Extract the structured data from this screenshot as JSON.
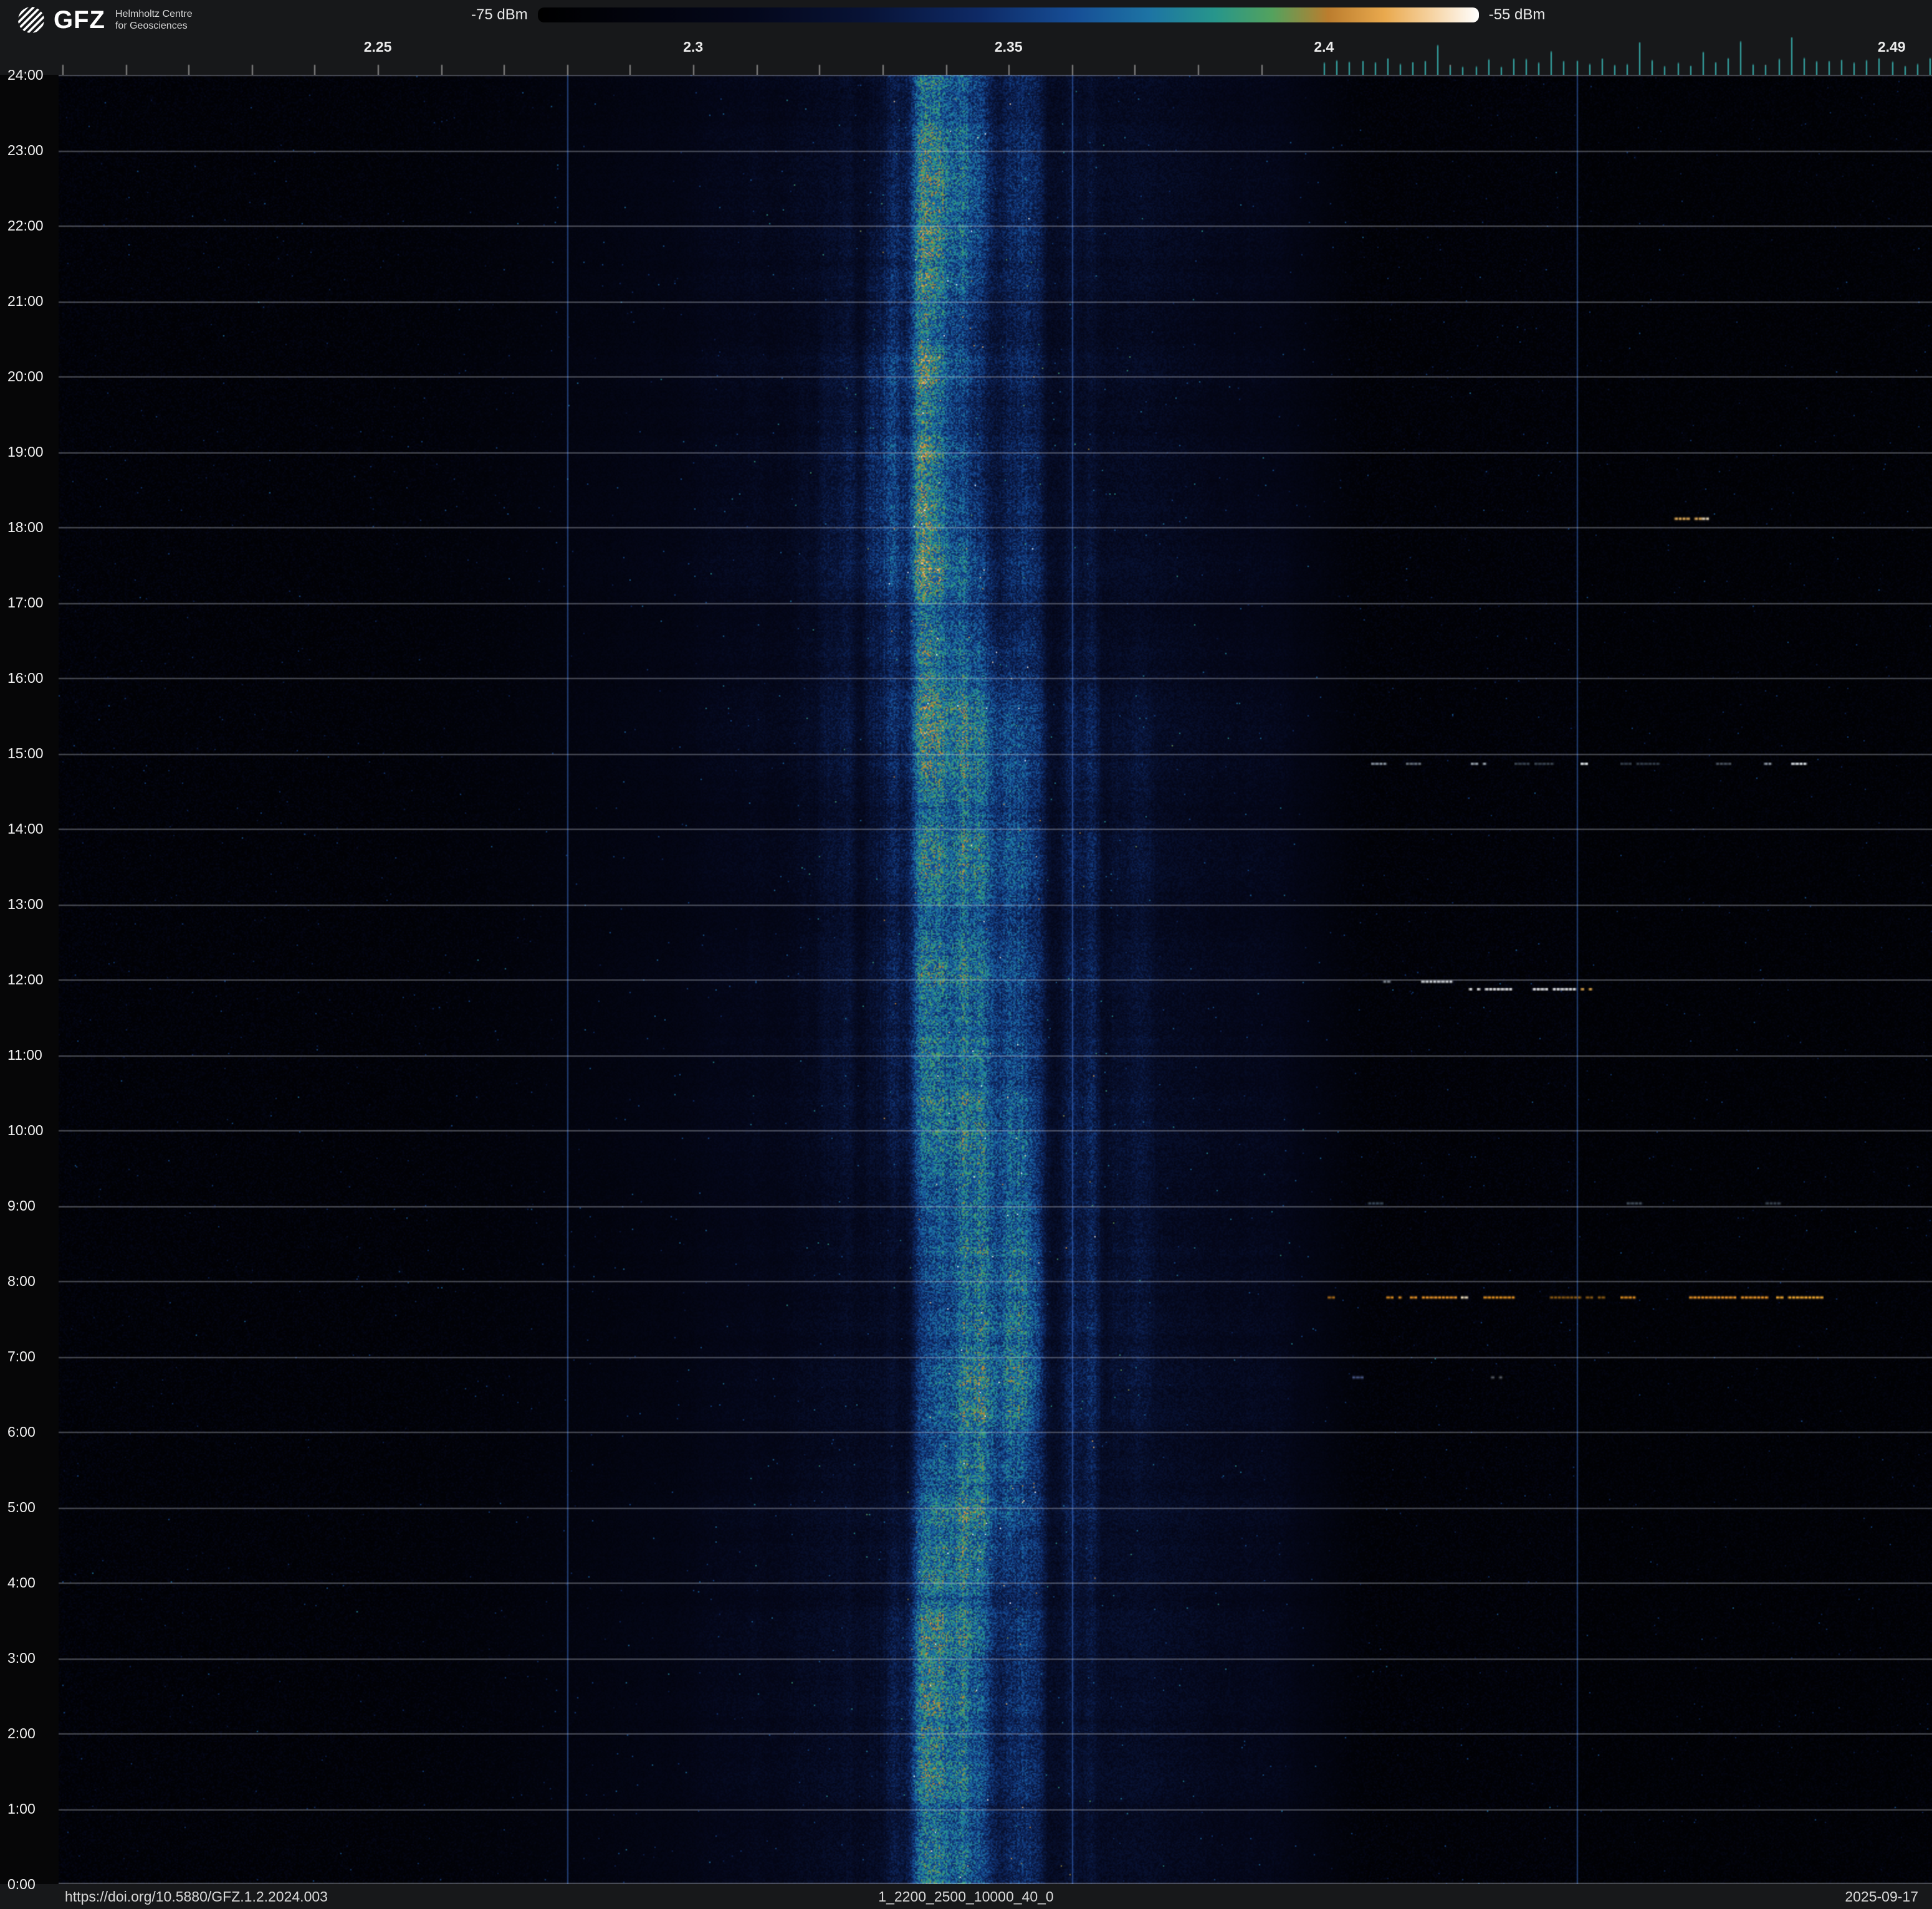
{
  "header": {
    "logo": {
      "brand": "GFZ",
      "subtitle_line1": "Helmholtz Centre",
      "subtitle_line2": "for Geosciences"
    },
    "colorbar": {
      "min_label": "-75 dBm",
      "max_label": "-55 dBm"
    }
  },
  "footer": {
    "doi": "https://doi.org/10.5880/GFZ.1.2.2024.003",
    "filename": "1_2200_2500_10000_40_0",
    "date": "2025-09-17"
  },
  "chart_data": {
    "type": "heatmap",
    "x_range_ghz": [
      2.1994,
      2.4964
    ],
    "y_range_hours": [
      0,
      24
    ],
    "noise_seed": 42,
    "color_scale": {
      "min_dbm": -75,
      "max_dbm": -55,
      "stops": [
        [
          0.0,
          "#000000"
        ],
        [
          0.22,
          "#04071a"
        ],
        [
          0.35,
          "#081336"
        ],
        [
          0.47,
          "#0e2a66"
        ],
        [
          0.57,
          "#164e96"
        ],
        [
          0.65,
          "#1d74a4"
        ],
        [
          0.72,
          "#27968b"
        ],
        [
          0.78,
          "#53a25e"
        ],
        [
          0.84,
          "#bb7d2e"
        ],
        [
          0.9,
          "#e9a94e"
        ],
        [
          0.95,
          "#f6d3a2"
        ],
        [
          1.0,
          "#ffffff"
        ]
      ]
    },
    "x_ticks": [
      {
        "ghz": 2.25,
        "label": "2.25"
      },
      {
        "ghz": 2.3,
        "label": "2.3"
      },
      {
        "ghz": 2.35,
        "label": "2.35"
      },
      {
        "ghz": 2.4,
        "label": "2.4"
      },
      {
        "ghz": 2.49,
        "label": "2.49"
      }
    ],
    "minor_tick_step_ghz": 0.01,
    "wifi_tick_region": {
      "start_ghz": 2.4,
      "end_ghz": 2.4964,
      "step_ghz": 0.002,
      "color": "#38b2b0"
    },
    "vertical_gridlines_ghz": [
      2.28,
      2.36,
      2.44
    ],
    "gridline_colors": {
      "horizontal": "rgba(205,210,220,0.38)",
      "vertical": "rgba(70,130,235,0.5)"
    },
    "y_ticks": [
      {
        "hour": 0,
        "label": "0:00"
      },
      {
        "hour": 1,
        "label": "1:00"
      },
      {
        "hour": 2,
        "label": "2:00"
      },
      {
        "hour": 3,
        "label": "3:00"
      },
      {
        "hour": 4,
        "label": "4:00"
      },
      {
        "hour": 5,
        "label": "5:00"
      },
      {
        "hour": 6,
        "label": "6:00"
      },
      {
        "hour": 7,
        "label": "7:00"
      },
      {
        "hour": 8,
        "label": "8:00"
      },
      {
        "hour": 9,
        "label": "9:00"
      },
      {
        "hour": 10,
        "label": "10:00"
      },
      {
        "hour": 11,
        "label": "11:00"
      },
      {
        "hour": 12,
        "label": "12:00"
      },
      {
        "hour": 13,
        "label": "13:00"
      },
      {
        "hour": 14,
        "label": "14:00"
      },
      {
        "hour": 15,
        "label": "15:00"
      },
      {
        "hour": 16,
        "label": "16:00"
      },
      {
        "hour": 17,
        "label": "17:00"
      },
      {
        "hour": 18,
        "label": "18:00"
      },
      {
        "hour": 19,
        "label": "19:00"
      },
      {
        "hour": 20,
        "label": "20:00"
      },
      {
        "hour": 21,
        "label": "21:00"
      },
      {
        "hour": 22,
        "label": "22:00"
      },
      {
        "hour": 23,
        "label": "23:00"
      },
      {
        "hour": 24,
        "label": "24:00"
      }
    ],
    "band": {
      "center_ghz": 2.3408,
      "drift_amp_ghz": 0.0035,
      "drift2_amp_ghz": 0.0013,
      "core": {
        "amp": 0.7,
        "sigma_ghz": 0.0105
      },
      "mid": {
        "amp": 0.45,
        "sigma_ghz": 0.023,
        "offset_ghz": 0.004
      },
      "halo": {
        "amp": 0.32,
        "sigma_ghz": 0.05,
        "offset_ghz": 0.008
      },
      "right_cutoff_ghz": 2.392,
      "right_cutoff_sigma": 0.01
    },
    "events": [
      {
        "hour": 18.11,
        "segments": [
          {
            "f0": 2.4556,
            "f1": 2.4599,
            "color": "#e8b05c"
          },
          {
            "f0": 2.4599,
            "f1": 2.461,
            "color": "#f5e2c0"
          }
        ]
      },
      {
        "hour": 14.86,
        "segments": [
          {
            "f0": 2.4075,
            "f1": 2.4095,
            "color": "#8a94a0"
          },
          {
            "f0": 2.413,
            "f1": 2.4154,
            "color": "#66707c"
          },
          {
            "f0": 2.4233,
            "f1": 2.4253,
            "color": "#9aa4ae"
          },
          {
            "f0": 2.4302,
            "f1": 2.4361,
            "color": "#39434f"
          },
          {
            "f0": 2.4407,
            "f1": 2.4415,
            "color": "#e8eef2"
          },
          {
            "f0": 2.447,
            "f1": 2.453,
            "color": "#333d49"
          },
          {
            "f0": 2.4609,
            "f1": 2.4648,
            "color": "#49525e"
          },
          {
            "f0": 2.4698,
            "f1": 2.4708,
            "color": "#8a94a0"
          },
          {
            "f0": 2.4741,
            "f1": 2.4763,
            "color": "#d8dee4"
          }
        ]
      },
      {
        "hour": 11.97,
        "segments": [
          {
            "f0": 2.4094,
            "f1": 2.4106,
            "color": "#7a828c"
          },
          {
            "f0": 2.4148,
            "f1": 2.4204,
            "color": "#cfd3d8"
          }
        ]
      },
      {
        "hour": 11.87,
        "segments": [
          {
            "f0": 2.423,
            "f1": 2.4401,
            "color": "#e4e6e8"
          },
          {
            "f0": 2.4401,
            "f1": 2.442,
            "color": "#d9a24a"
          }
        ]
      },
      {
        "hour": 9.03,
        "segments": [
          {
            "f0": 2.407,
            "f1": 2.409,
            "color": "#3a4a5a"
          },
          {
            "f0": 2.448,
            "f1": 2.45,
            "color": "#44505c"
          },
          {
            "f0": 2.47,
            "f1": 2.472,
            "color": "#3a4450"
          }
        ]
      },
      {
        "hour": 7.78,
        "segments": [
          {
            "f0": 2.4006,
            "f1": 2.4016,
            "color": "#a86a18"
          },
          {
            "f0": 2.4099,
            "f1": 2.4125,
            "color": "#d88a20"
          },
          {
            "f0": 2.413,
            "f1": 2.4209,
            "color": "#e89428"
          },
          {
            "f0": 2.4217,
            "f1": 2.4229,
            "color": "#f0e0c0"
          },
          {
            "f0": 2.4253,
            "f1": 2.4308,
            "color": "#e09020"
          },
          {
            "f0": 2.4352,
            "f1": 2.4441,
            "color": "#8a5a14"
          },
          {
            "f0": 2.447,
            "f1": 2.449,
            "color": "#d88a20"
          },
          {
            "f0": 2.4579,
            "f1": 2.4708,
            "color": "#e89428"
          },
          {
            "f0": 2.4717,
            "f1": 2.479,
            "color": "#f0a830"
          }
        ]
      },
      {
        "hour": 6.72,
        "segments": [
          {
            "f0": 2.4045,
            "f1": 2.4058,
            "color": "#4a5a88"
          },
          {
            "f0": 2.4265,
            "f1": 2.4278,
            "color": "#5a5f66"
          }
        ]
      }
    ]
  }
}
